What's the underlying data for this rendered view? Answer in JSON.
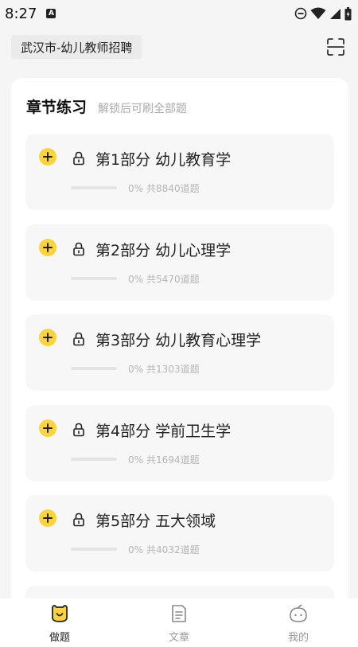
{
  "status_bar": {
    "time": "8:27",
    "indicator_letter": "A",
    "icons": [
      "do-not-disturb-icon",
      "wifi-icon",
      "signal-icon",
      "battery-icon"
    ]
  },
  "header": {
    "location": "武汉市-幼儿教师招聘",
    "scan_icon": "scan-icon"
  },
  "section": {
    "title": "章节练习",
    "subtitle": "解锁后可刷全部题"
  },
  "chapters": [
    {
      "name": "第1部分 幼儿教育学",
      "progress_label": "0%",
      "total_label": "共8840道题",
      "progress": 0
    },
    {
      "name": "第2部分 幼儿心理学",
      "progress_label": "0%",
      "total_label": "共5470道题",
      "progress": 0
    },
    {
      "name": "第3部分 幼儿教育心理学",
      "progress_label": "0%",
      "total_label": "共1303道题",
      "progress": 0
    },
    {
      "name": "第4部分 学前卫生学",
      "progress_label": "0%",
      "total_label": "共1694道题",
      "progress": 0
    },
    {
      "name": "第5部分 五大领域",
      "progress_label": "0%",
      "total_label": "共4032道题",
      "progress": 0
    }
  ],
  "bottom_nav": [
    {
      "label": "做题",
      "icon": "practice-icon",
      "active": true
    },
    {
      "label": "文章",
      "icon": "article-icon",
      "active": false
    },
    {
      "label": "我的",
      "icon": "profile-icon",
      "active": false
    }
  ],
  "colors": {
    "accent": "#fcd33a",
    "background": "#f5f5f5",
    "card": "#ffffff",
    "item_bg": "#f7f7f7"
  }
}
